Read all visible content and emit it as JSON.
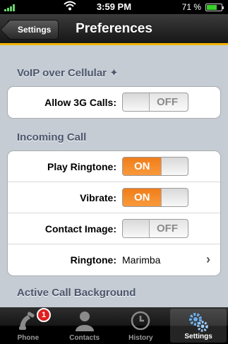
{
  "status_bar": {
    "carrier": ".ııll",
    "time": "3:59 PM",
    "battery_percent": "71 %",
    "battery_level": 0.71
  },
  "nav": {
    "back_label": "Settings",
    "title": "Preferences"
  },
  "sections": {
    "voip": {
      "header": "VoIP over Cellular ✦",
      "rows": [
        {
          "label": "Allow 3G Calls:",
          "state": "OFF"
        }
      ]
    },
    "incoming": {
      "header": "Incoming Call",
      "rows": [
        {
          "label": "Play Ringtone:",
          "state": "ON"
        },
        {
          "label": "Vibrate:",
          "state": "ON"
        },
        {
          "label": "Contact Image:",
          "state": "OFF"
        },
        {
          "label": "Ringtone:",
          "value": "Marimba"
        }
      ]
    },
    "active_bg": {
      "header": "Active Call Background"
    }
  },
  "tabs": [
    {
      "label": "Phone",
      "icon": "phone-icon",
      "badge": "1"
    },
    {
      "label": "Contacts",
      "icon": "contacts-icon"
    },
    {
      "label": "History",
      "icon": "clock-icon"
    },
    {
      "label": "Settings",
      "icon": "gears-icon",
      "active": true
    }
  ],
  "colors": {
    "accent_bar": "#f4b400",
    "toggle_on": "#f07d1a",
    "section_header": "#4c566c",
    "badge": "#e01f1f"
  }
}
